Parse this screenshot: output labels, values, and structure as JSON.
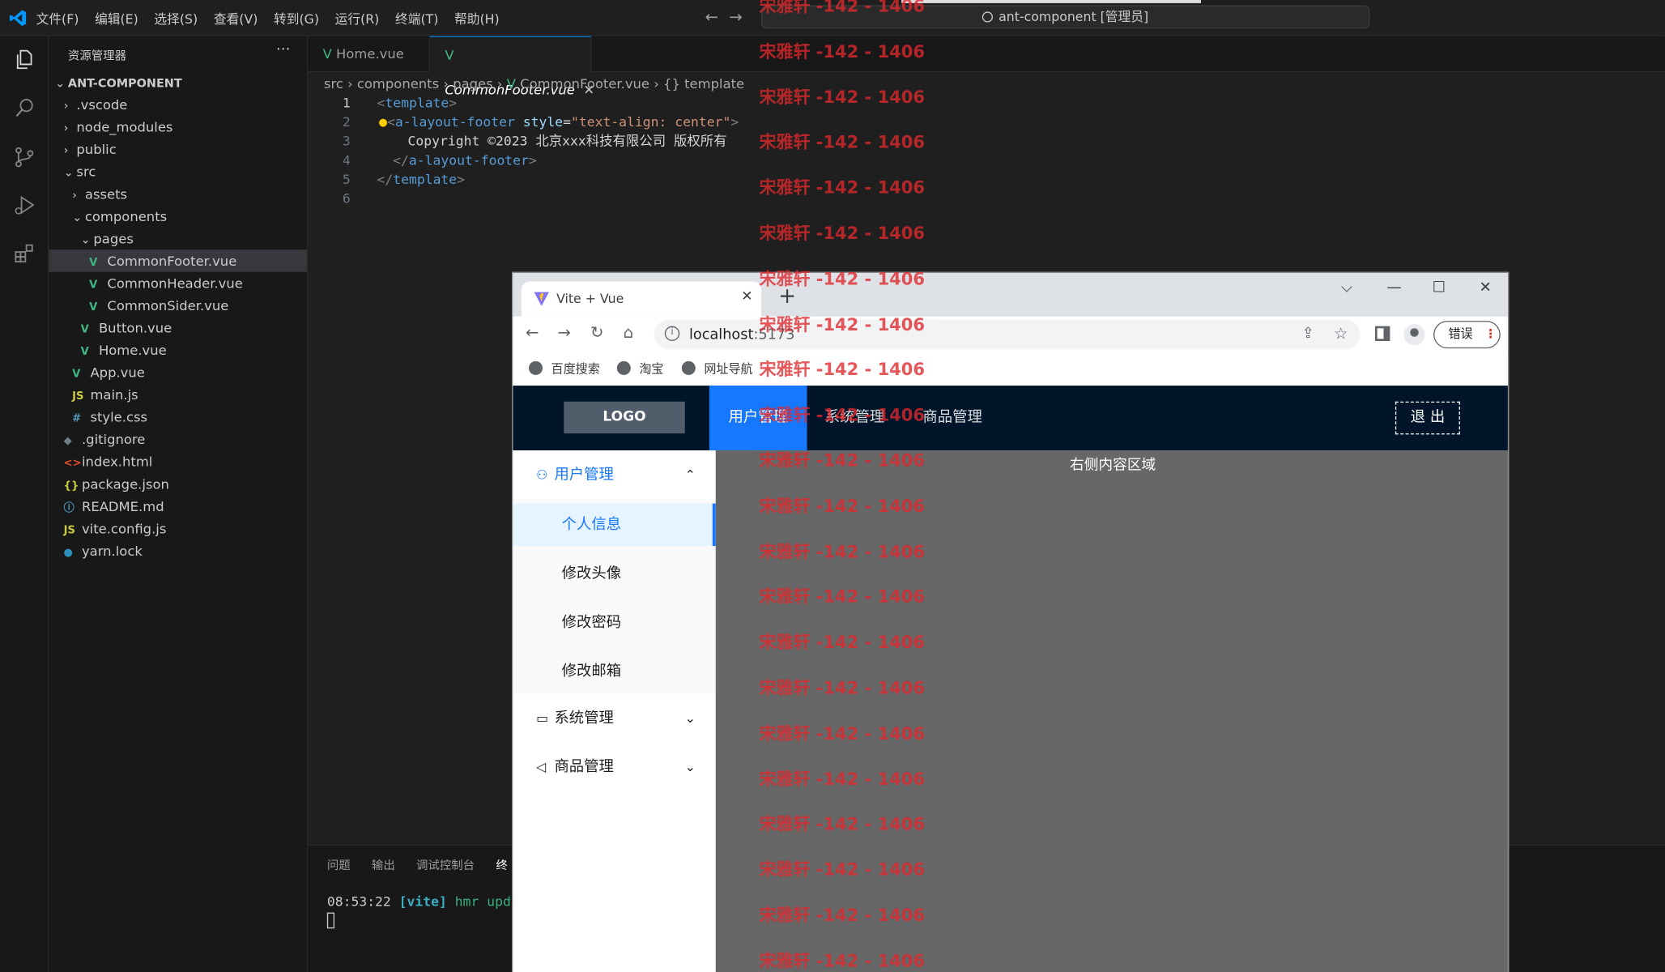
{
  "vscode": {
    "menu": [
      "文件(F)",
      "编辑(E)",
      "选择(S)",
      "查看(V)",
      "转到(G)",
      "运行(R)",
      "终端(T)",
      "帮助(H)"
    ],
    "search_text": "ant-component [管理员]",
    "explorer_title": "资源管理器",
    "more": "···",
    "root": "ANT-COMPONENT",
    "tree": [
      {
        "label": ".vscode",
        "chev": "›",
        "icon": "",
        "depth": 1
      },
      {
        "label": "node_modules",
        "chev": "›",
        "icon": "",
        "depth": 1
      },
      {
        "label": "public",
        "chev": "›",
        "icon": "",
        "depth": 1
      },
      {
        "label": "src",
        "chev": "⌄",
        "icon": "",
        "depth": 1
      },
      {
        "label": "assets",
        "chev": "›",
        "icon": "",
        "depth": 2
      },
      {
        "label": "components",
        "chev": "⌄",
        "icon": "",
        "depth": 2
      },
      {
        "label": "pages",
        "chev": "⌄",
        "icon": "",
        "depth": 3
      },
      {
        "label": "CommonFooter.vue",
        "chev": "",
        "icon": "V",
        "depth": 4
      },
      {
        "label": "CommonHeader.vue",
        "chev": "",
        "icon": "V",
        "depth": 4
      },
      {
        "label": "CommonSider.vue",
        "chev": "",
        "icon": "V",
        "depth": 4
      },
      {
        "label": "Button.vue",
        "chev": "",
        "icon": "V",
        "depth": 3
      },
      {
        "label": "Home.vue",
        "chev": "",
        "icon": "V",
        "depth": 3
      },
      {
        "label": "App.vue",
        "chev": "",
        "icon": "V",
        "depth": 2
      },
      {
        "label": "main.js",
        "chev": "",
        "icon": "JS",
        "depth": 2
      },
      {
        "label": "style.css",
        "chev": "",
        "icon": "#",
        "depth": 2
      },
      {
        "label": ".gitignore",
        "chev": "",
        "icon": "◆",
        "depth": 1
      },
      {
        "label": "index.html",
        "chev": "",
        "icon": "<>",
        "depth": 1
      },
      {
        "label": "package.json",
        "chev": "",
        "icon": "{}",
        "depth": 1
      },
      {
        "label": "README.md",
        "chev": "",
        "icon": "ⓘ",
        "depth": 1
      },
      {
        "label": "vite.config.js",
        "chev": "",
        "icon": "JS",
        "depth": 1
      },
      {
        "label": "yarn.lock",
        "chev": "",
        "icon": "●",
        "depth": 1
      }
    ],
    "tabs": [
      {
        "label": "Home.vue",
        "active": false
      },
      {
        "label": "CommonFooter.vue",
        "active": true
      }
    ],
    "tab_close": "✕",
    "breadcrumb": [
      "src",
      "components",
      "pages",
      "CommonFooter.vue",
      "template"
    ],
    "line_numbers": [
      "1",
      "2",
      "3",
      "4",
      "5",
      "6"
    ],
    "code": {
      "l1_open": "<",
      "l1_tag": "template",
      "l1_close": ">",
      "l2_tag": "a-layout-footer",
      "l2_attr": "style",
      "l2_eq": "=",
      "l2_val": "\"text-align: center\"",
      "l3_text": "Copyright ©2023 北京xxx科技有限公司 版权所有",
      "l4_tag": "a-layout-footer",
      "l5_tag": "template"
    },
    "panel_tabs": [
      "问题",
      "输出",
      "调试控制台",
      "终"
    ],
    "terminal": {
      "time": "08:53:22 ",
      "vite": "[vite]",
      "msg": " hmr updat"
    }
  },
  "browser": {
    "tab_title": "Vite + Vue",
    "tab_close": "✕",
    "new_tab": "+",
    "url_host": "localhost",
    "url_port": ":5173",
    "error_label": "错误",
    "bookmarks": [
      "百度搜索",
      "淘宝",
      "网址导航"
    ]
  },
  "app": {
    "logo": "LOGO",
    "nav": [
      {
        "label": "用户管理",
        "active": true
      },
      {
        "label": "系统管理",
        "active": false
      },
      {
        "label": "商品管理",
        "active": false
      }
    ],
    "logout": "退 出",
    "sider": {
      "groups": [
        {
          "label": "用户管理",
          "open": true,
          "icon": "user-icon"
        },
        {
          "label": "系统管理",
          "open": false,
          "icon": "laptop-icon"
        },
        {
          "label": "商品管理",
          "open": false,
          "icon": "notification-icon"
        }
      ],
      "items": [
        "个人信息",
        "修改头像",
        "修改密码",
        "修改邮箱"
      ],
      "selected_item": "个人信息"
    },
    "content": "右侧内容区域"
  },
  "watermark": {
    "text": "宋雅轩 -142 - 1406",
    "color": "#e0282d"
  },
  "colors": {
    "accent": "#1677ff",
    "header_bg": "#001529",
    "content_bg": "#676767",
    "vue_green": "#41b883"
  }
}
